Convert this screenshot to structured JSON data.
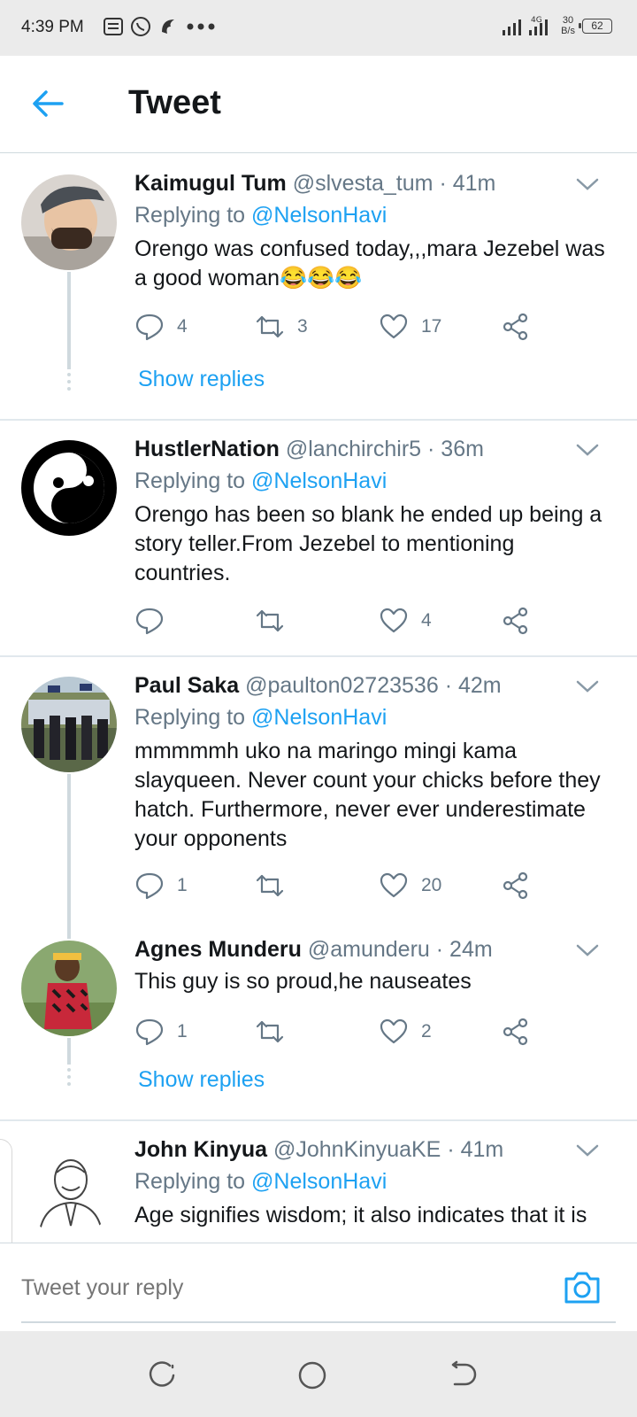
{
  "status_bar": {
    "time": "4:39 PM",
    "network": "4G",
    "speed_value": "30",
    "speed_unit": "B/s",
    "battery": "62",
    "icons": [
      "notification-icon",
      "whatsapp-icon",
      "app-icon",
      "more-icon",
      "signal-icon",
      "battery-icon"
    ]
  },
  "header": {
    "title": "Tweet",
    "back_icon": "arrow-left-icon"
  },
  "tweets": [
    {
      "name": "Kaimugul Tum",
      "handle": "@slvesta_tum",
      "time": "· 41m",
      "replying_prefix": "Replying to",
      "mention": "@NelsonHavi",
      "text": "Orengo was confused today,,,mara Jezebel was a good woman😂😂😂",
      "replies": "4",
      "retweets": "3",
      "likes": "17",
      "show_replies": "Show replies"
    },
    {
      "name": "HustlerNation",
      "handle": "@lanchirchir5",
      "time": "· 36m",
      "replying_prefix": "Replying to",
      "mention": "@NelsonHavi",
      "text": "Orengo has been so blank he ended up being a story teller.From Jezebel to mentioning countries.",
      "replies": "",
      "retweets": "",
      "likes": "4"
    },
    {
      "name": "Paul Saka",
      "handle": "@paulton02723536",
      "time": "· 42m",
      "replying_prefix": "Replying to",
      "mention": "@NelsonHavi",
      "text": "mmmmmh uko na maringo mingi kama slayqueen. Never count your chicks before they hatch. Furthermore, never ever underestimate your opponents",
      "replies": "1",
      "retweets": "",
      "likes": "20"
    },
    {
      "name": "Agnes Munderu",
      "handle": "@amunderu",
      "time": "· 24m",
      "text": "This guy is so proud,he nauseates",
      "replies": "1",
      "retweets": "",
      "likes": "2",
      "show_replies": "Show replies"
    },
    {
      "name": "John Kinyua",
      "handle": "@JohnKinyuaKE",
      "time": "· 41m",
      "replying_prefix": "Replying to",
      "mention": "@NelsonHavi",
      "text": "Age signifies wisdom; it also indicates that it is"
    }
  ],
  "reply_bar": {
    "placeholder": "Tweet your reply",
    "camera_icon": "camera-icon"
  },
  "colors": {
    "accent": "#1da1f2",
    "secondary_text": "#657786",
    "primary_text": "#14171a",
    "divider": "#e1e8ed",
    "system_bar": "#ebebeb"
  }
}
